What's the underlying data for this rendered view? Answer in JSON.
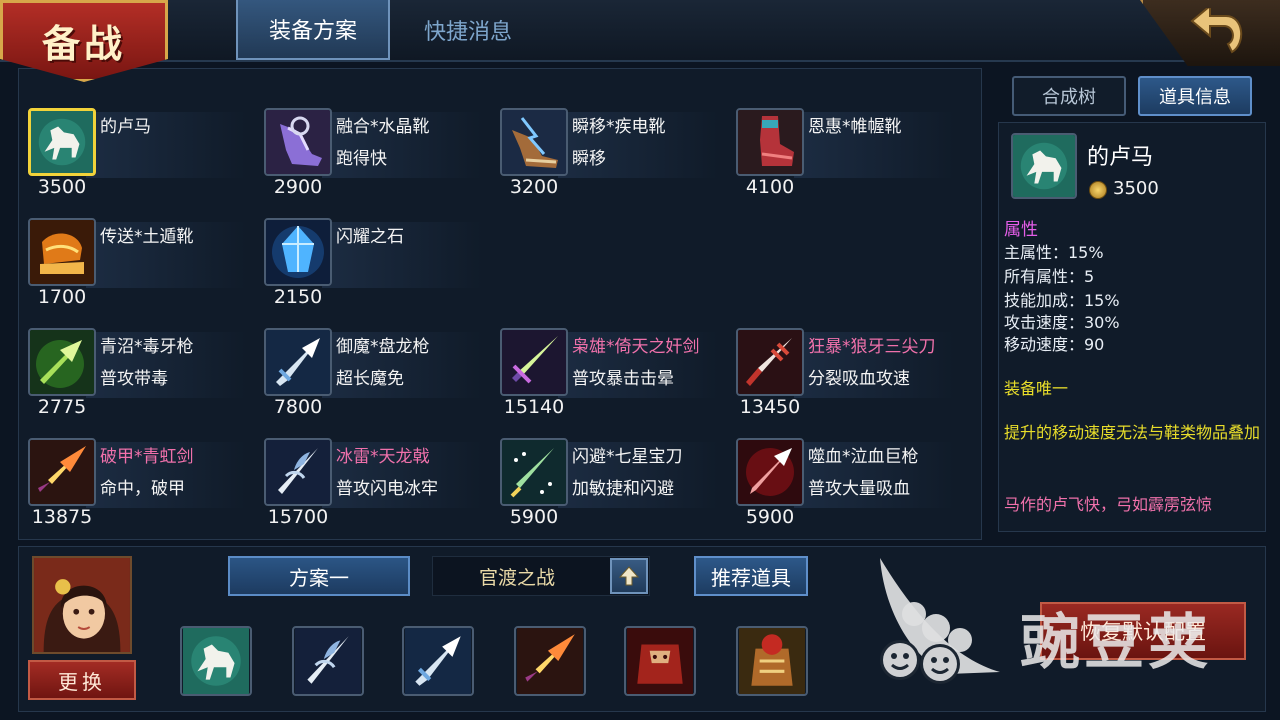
{
  "header": {
    "title": "备战",
    "tabs": [
      {
        "label": "装备方案",
        "active": true
      },
      {
        "label": "快捷消息",
        "active": false
      }
    ]
  },
  "items": [
    {
      "name": "的卢马",
      "desc": "",
      "price": "3500",
      "name_color": "white",
      "icon": "white-horse-icon",
      "selected": true
    },
    {
      "name": "融合*水晶靴",
      "desc": "跑得快",
      "price": "2900",
      "name_color": "white",
      "icon": "crystal-boots-icon"
    },
    {
      "name": "瞬移*疾电靴",
      "desc": "瞬移",
      "price": "3200",
      "name_color": "white",
      "icon": "lightning-boots-icon"
    },
    {
      "name": "恩惠*帷幄靴",
      "desc": "",
      "price": "4100",
      "name_color": "white",
      "icon": "red-boots-icon"
    },
    {
      "name": "传送*土遁靴",
      "desc": "",
      "price": "1700",
      "name_color": "white",
      "icon": "earth-boots-icon"
    },
    {
      "name": "闪耀之石",
      "desc": "",
      "price": "2150",
      "name_color": "white",
      "icon": "blue-crystal-icon"
    },
    {
      "name": "青沼*毒牙枪",
      "desc": "普攻带毒",
      "price": "2775",
      "name_color": "white",
      "icon": "poison-spear-icon"
    },
    {
      "name": "御魔*盘龙枪",
      "desc": "超长魔免",
      "price": "7800",
      "name_color": "white",
      "icon": "dragon-spear-icon"
    },
    {
      "name": "枭雄*倚天之奸剑",
      "desc": "普攻暴击击晕",
      "price": "15140",
      "name_color": "pink",
      "icon": "green-sword-icon"
    },
    {
      "name": "狂暴*狼牙三尖刀",
      "desc": "分裂吸血攻速",
      "price": "13450",
      "name_color": "pink",
      "icon": "trident-blade-icon"
    },
    {
      "name": "破甲*青虹剑",
      "desc": "命中，破甲",
      "price": "13875",
      "name_color": "pink",
      "icon": "golden-sword-icon"
    },
    {
      "name": "冰雷*天龙戟",
      "desc": "普攻闪电冰牢",
      "price": "15700",
      "name_color": "pink",
      "icon": "halberd-icon"
    },
    {
      "name": "闪避*七星宝刀",
      "desc": "加敏捷和闪避",
      "price": "5900",
      "name_color": "white",
      "icon": "seven-star-blade-icon"
    },
    {
      "name": "噬血*泣血巨枪",
      "desc": "普攻大量吸血",
      "price": "5900",
      "name_color": "white",
      "icon": "blood-spear-icon"
    }
  ],
  "right_panel": {
    "buttons": [
      {
        "label": "合成树",
        "active": false
      },
      {
        "label": "道具信息",
        "active": true
      }
    ],
    "item_name": "的卢马",
    "price": "3500",
    "attr_heading": "属性",
    "attributes": [
      "主属性：15%",
      "所有属性：5",
      "技能加成：15%",
      "攻击速度：30%",
      "移动速度：90"
    ],
    "unique": "装备唯一",
    "note": "提升的移动速度无法与鞋类物品叠加",
    "flavor": "马作的卢飞快，弓如霹雳弦惊"
  },
  "bottom": {
    "change_label": "更换",
    "plan_label": "方案一",
    "battle_label": "官渡之战",
    "recommend_label": "推荐道具",
    "restore_label": "恢复默认配置",
    "slots": [
      "white-horse-icon",
      "halberd-icon",
      "dragon-spear-icon",
      "golden-sword-icon",
      "red-demon-armor-icon",
      "armored-warrior-icon"
    ]
  },
  "watermark": {
    "text": "豌豆荚"
  },
  "colors": {
    "pink_name": "#f071ab",
    "yellow_text": "#e9de2a",
    "attr_heading": "#e55ee8"
  }
}
